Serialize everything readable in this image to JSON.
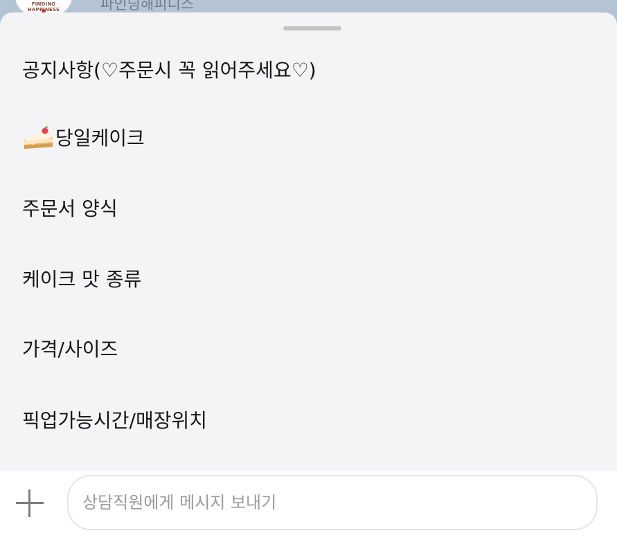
{
  "header": {
    "channel_name": "파인딩해피니스",
    "avatar_text": "FINDING HAPPINESS"
  },
  "menu": {
    "items": [
      {
        "label": "공지사항(♡주문시 꼭 읽어주세요♡)",
        "icon": ""
      },
      {
        "label": "당일케이크",
        "icon": "cake-slice-icon"
      },
      {
        "label": "주문서 양식",
        "icon": ""
      },
      {
        "label": "케이크 맛 종류",
        "icon": ""
      },
      {
        "label": "가격/사이즈",
        "icon": ""
      },
      {
        "label": "픽업가능시간/매장위치",
        "icon": ""
      }
    ]
  },
  "composer": {
    "placeholder": "상담직원에게 메시지 보내기",
    "add_icon": "plus-icon"
  },
  "colors": {
    "header_bg": "#b3c4d4",
    "sheet_bg": "#f4f4f6",
    "composer_bg": "#ffffff"
  }
}
